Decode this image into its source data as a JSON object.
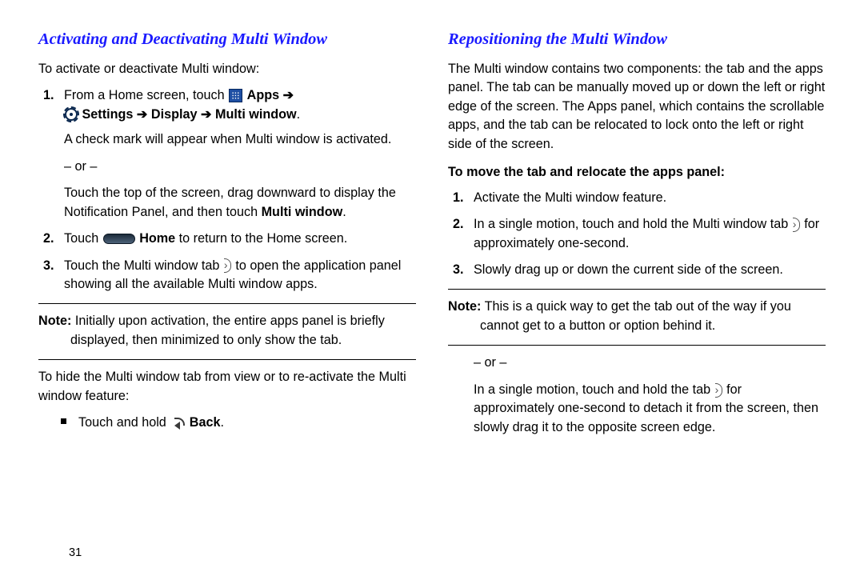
{
  "left": {
    "heading": "Activating and Deactivating Multi Window",
    "intro": "To activate or deactivate Multi window:",
    "step1_a": "From a Home screen, touch ",
    "apps_word": " Apps ",
    "arrow": "➔",
    "settings_line": " Settings ➔ Display ➔ Multi window",
    "period": ".",
    "checkmark": "A check mark will appear when Multi window is activated.",
    "or": "– or –",
    "touch_top": "Touch the top of the screen, drag downward to display the Notification Panel, and then touch ",
    "multi_window_bold": "Multi window",
    "step2_a": "Touch ",
    "home_bold": " Home",
    "step2_b": " to return to the Home screen.",
    "step3_a": "Touch the Multi window tab ",
    "step3_b": " to open the application panel showing all the available Multi window apps.",
    "note_label": "Note:",
    "note_body": " Initially upon activation, the entire apps panel is briefly displayed, then minimized to only show the tab.",
    "hide_intro": "To hide the Multi window tab from view or to re-activate the Multi window feature:",
    "bullet_a": "Touch and hold ",
    "back_bold": " Back",
    "page": "31"
  },
  "right": {
    "heading": "Repositioning the Multi Window",
    "intro": "The Multi window contains two components: the tab and the apps panel. The tab can be manually moved up or down the left or right edge of the screen. The Apps panel, which contains the scrollable apps, and the tab can be relocated to lock onto the left or right side of the screen.",
    "to_move": "To move the tab and relocate the apps panel:",
    "r1": "Activate the Multi window feature.",
    "r2a": "In a single motion, touch and hold the Multi window tab ",
    "r2b": " for approximately one-second.",
    "r3": "Slowly drag up or down the current side of the screen.",
    "note_label": "Note:",
    "note_body": " This is a quick way to get the tab out of the way if you cannot get to a button or option behind it.",
    "or": "– or –",
    "post_a": "In a single motion, touch and hold the tab ",
    "post_b": " for approximately one-second to detach it from the screen, then slowly drag it to the opposite screen edge."
  }
}
